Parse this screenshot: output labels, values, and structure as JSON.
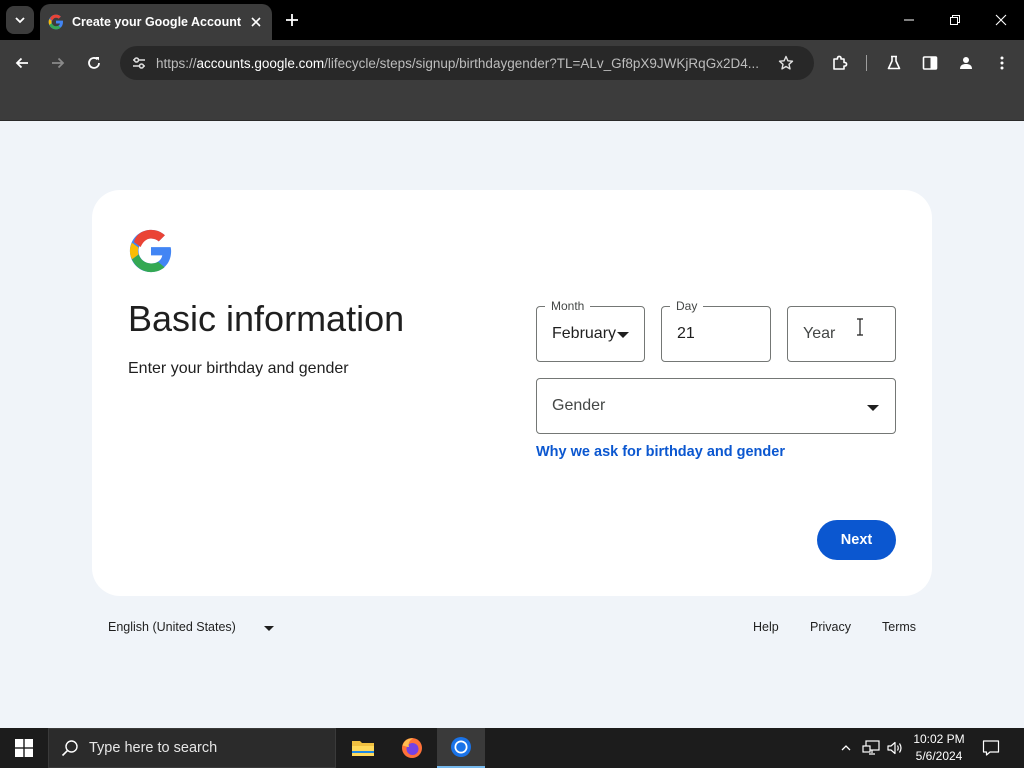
{
  "browser": {
    "tab_title": "Create your Google Account",
    "url_scheme": "https://",
    "url_host": "accounts.google.com",
    "url_path": "/lifecycle/steps/signup/birthdaygender?TL=ALv_Gf8pX9JWKjRqGx2D4..."
  },
  "page": {
    "title": "Basic information",
    "subtitle": "Enter your birthday and gender",
    "month": {
      "label": "Month",
      "value": "February"
    },
    "day": {
      "label": "Day",
      "value": "21"
    },
    "year": {
      "placeholder": "Year"
    },
    "gender": {
      "placeholder": "Gender"
    },
    "why_link": "Why we ask for birthday and gender",
    "next_label": "Next"
  },
  "footer": {
    "language": "English (United States)",
    "help": "Help",
    "privacy": "Privacy",
    "terms": "Terms"
  },
  "taskbar": {
    "search_placeholder": "Type here to search",
    "time": "10:02 PM",
    "date": "5/6/2024"
  },
  "colors": {
    "accent": "#0b57d0",
    "page_bg": "#f0f4f9",
    "chrome_bg": "#3c3c3c"
  }
}
